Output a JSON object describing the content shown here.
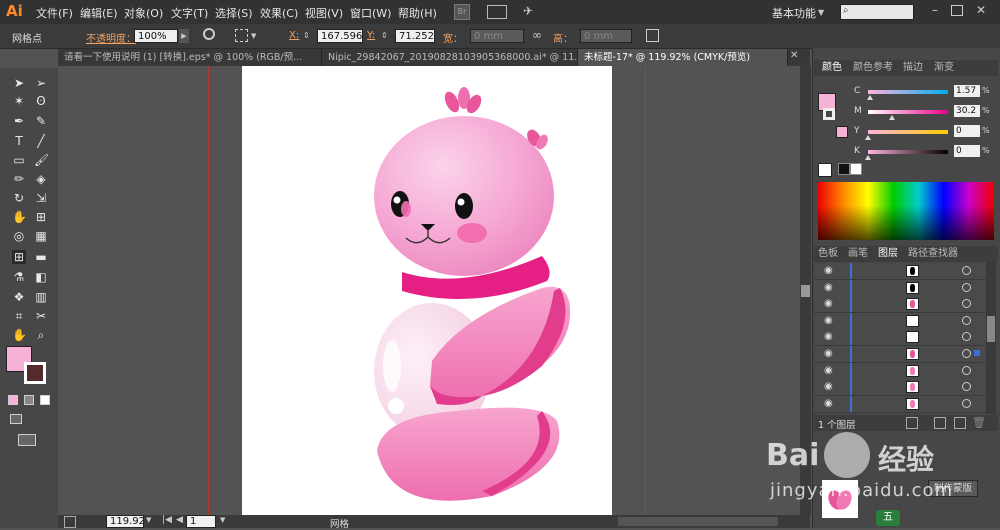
{
  "app": {
    "logo": "Ai",
    "workspace": "基本功能"
  },
  "menu": [
    "文件(F)",
    "编辑(E)",
    "对象(O)",
    "文字(T)",
    "选择(S)",
    "效果(C)",
    "视图(V)",
    "窗口(W)",
    "帮助(H)"
  ],
  "control": {
    "mode": "网格点",
    "opacity_label": "不透明度：",
    "opacity_value": "100%",
    "x_label": "X:",
    "x_value": "167.596",
    "y_label": "Y:",
    "y_value": "71.252",
    "w_label": "宽：",
    "w_value": "0 mm",
    "h_label": "高：",
    "h_value": "0 mm"
  },
  "tabs": [
    {
      "label": "请看一下使用说明 (1) [转换].eps* @ 100% (RGB/预..."
    },
    {
      "label": "Nipic_29842067_20190828103905368000.ai* @ 11..."
    },
    {
      "label": "未标题-17* @ 119.92% (CMYK/预览)"
    }
  ],
  "color_panel": {
    "tabs": [
      "颜色",
      "颜色参考",
      "描边",
      "渐变"
    ],
    "channels": [
      {
        "name": "C",
        "value": "1.57",
        "unit": "%",
        "level": 0.02,
        "gradient": [
          "#ffb3dc",
          "#00aeef"
        ]
      },
      {
        "name": "M",
        "value": "30.2",
        "unit": "%",
        "level": 0.3,
        "gradient": [
          "#ffffff",
          "#ec008c"
        ]
      },
      {
        "name": "Y",
        "value": "0",
        "unit": "%",
        "level": 0.0,
        "gradient": [
          "#ffb3dc",
          "#ffcc00"
        ]
      },
      {
        "name": "K",
        "value": "0",
        "unit": "%",
        "level": 0.0,
        "gradient": [
          "#ffb3dc",
          "#000000"
        ]
      }
    ],
    "fill": "#f6b1d6"
  },
  "layers_panel": {
    "tabs": [
      "色板",
      "画笔",
      "图层",
      "路径查找器"
    ],
    "footer": "1 个图层"
  },
  "status": {
    "zoom": "119.92",
    "page": "1",
    "tool": "网格"
  },
  "watermark": {
    "brand": "Bai",
    "brand2": "经验",
    "url": "jingyan.baidu.com"
  },
  "bottom_panel": {
    "make_mask": "制作蒙版",
    "ime": "五"
  }
}
